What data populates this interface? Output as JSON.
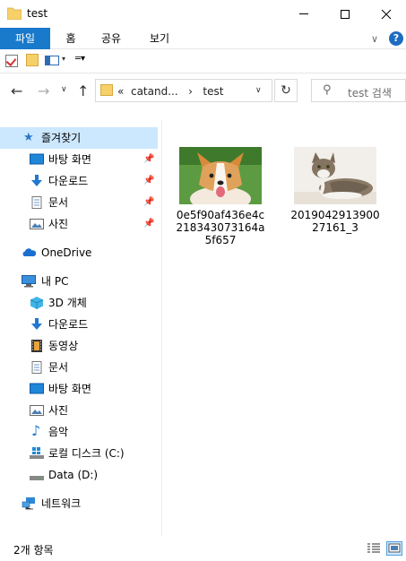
{
  "window": {
    "title": "test",
    "min_icon": "minimize-icon",
    "max_icon": "maximize-icon",
    "close_icon": "close-icon"
  },
  "ribbon": {
    "tabs": [
      "파일",
      "홈",
      "공유",
      "보기"
    ],
    "help": "?",
    "accent": "#1979ca"
  },
  "address": {
    "crumb_prefix": "«",
    "crumb_parent": "catand...",
    "crumb_sep": "›",
    "crumb_current": "test"
  },
  "search": {
    "placeholder": "test 검색"
  },
  "sidebar": {
    "quick_access": "즐겨찾기",
    "quick_items": [
      "바탕 화면",
      "다운로드",
      "문서",
      "사진"
    ],
    "onedrive": "OneDrive",
    "this_pc": "내 PC",
    "pc_items": [
      "3D 개체",
      "다운로드",
      "동영상",
      "문서",
      "바탕 화면",
      "사진",
      "음악",
      "로컬 디스크 (C:)",
      "Data (D:)"
    ],
    "network": "네트워크"
  },
  "files": [
    {
      "name_lines": [
        "0e5f90af436e4c",
        "218343073164a",
        "5f657"
      ],
      "kind": "dog-photo"
    },
    {
      "name_lines": [
        "2019042913900",
        "27161_3"
      ],
      "kind": "cat-photo"
    }
  ],
  "status": {
    "count_text": "2개 항목"
  }
}
